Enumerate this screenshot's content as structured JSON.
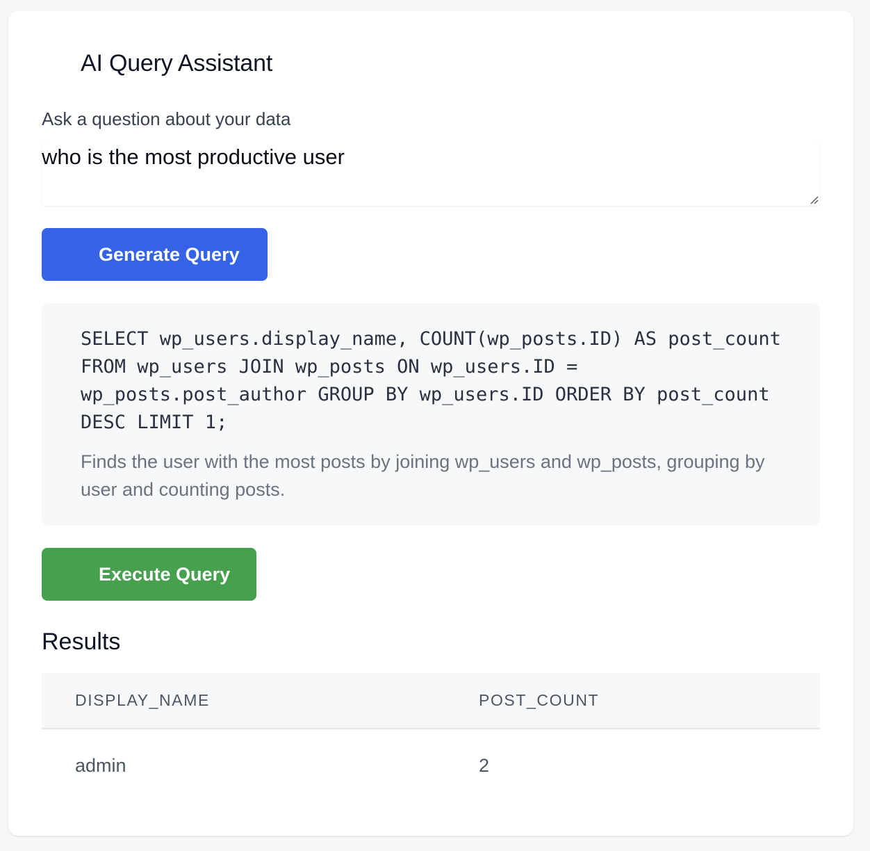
{
  "header": {
    "title": "AI Query Assistant"
  },
  "prompt": {
    "label": "Ask a question about your data",
    "value": "who is the most productive user"
  },
  "actions": {
    "generate_label": "Generate Query",
    "execute_label": "Execute Query"
  },
  "generated": {
    "sql": "SELECT wp_users.display_name, COUNT(wp_posts.ID) AS post_count FROM wp_users JOIN wp_posts ON wp_users.ID = wp_posts.post_author GROUP BY wp_users.ID ORDER BY post_count DESC LIMIT 1;",
    "explanation": "Finds the user with the most posts by joining wp_users and wp_posts, grouping by user and counting posts."
  },
  "results": {
    "heading": "Results",
    "columns": [
      "DISPLAY_NAME",
      "POST_COUNT"
    ],
    "rows": [
      [
        "admin",
        "2"
      ]
    ]
  },
  "colors": {
    "generate_button": "#3563e6",
    "execute_button": "#46a04e",
    "page_background": "#f6f7f9"
  }
}
